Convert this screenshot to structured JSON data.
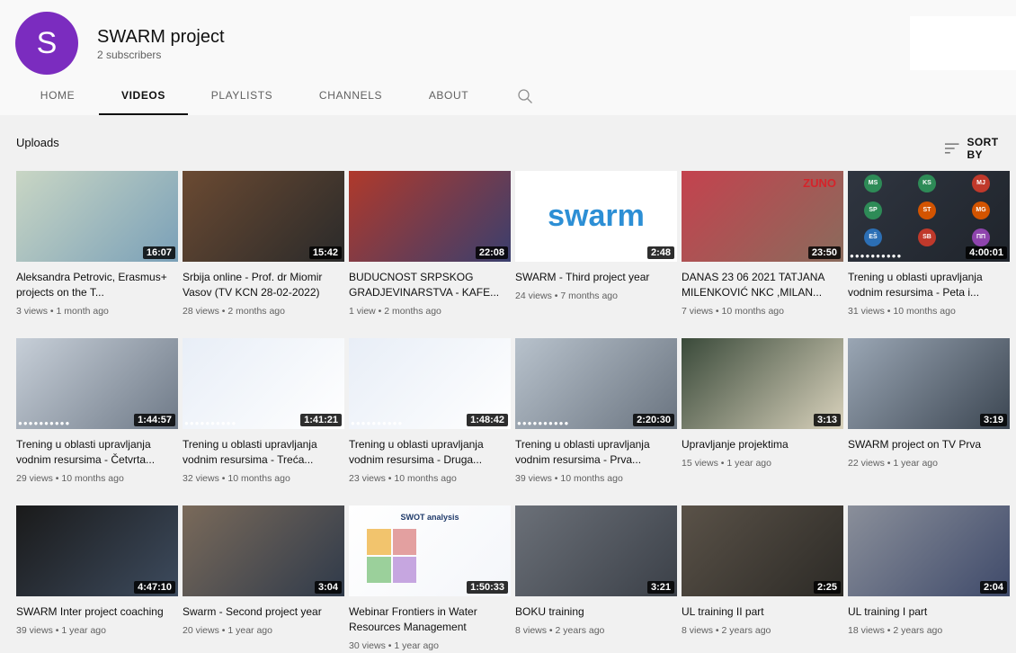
{
  "channel": {
    "avatar_letter": "S",
    "avatar_color": "#7b2cbf",
    "name": "SWARM project",
    "subscribers": "2 subscribers"
  },
  "tabs": [
    "HOME",
    "VIDEOS",
    "PLAYLISTS",
    "CHANNELS",
    "ABOUT"
  ],
  "active_tab": "VIDEOS",
  "section": {
    "label": "Uploads",
    "sort_label": "SORT BY"
  },
  "videos": [
    {
      "title": "Aleksandra Petrovic, Erasmus+ projects on the T...",
      "meta": "3 views • 1 month ago",
      "duration": "16:07"
    },
    {
      "title": "Srbija online - Prof. dr Miomir Vasov (TV KCN 28-02-2022)",
      "meta": "28 views • 2 months ago",
      "duration": "15:42"
    },
    {
      "title": "BUDUCNOST SRPSKOG GRADJEVINARSTVA - KAFE...",
      "meta": "1 view • 2 months ago",
      "duration": "22:08"
    },
    {
      "title": "SWARM - Third project year",
      "meta": "24 views • 7 months ago",
      "duration": "2:48",
      "thumb_text": "swarm"
    },
    {
      "title": "DANAS 23 06 2021 TATJANA MILENKOVIĆ NKC ,MILAN...",
      "meta": "7 views • 10 months ago",
      "duration": "23:50",
      "thumb_text": "ZUNO"
    },
    {
      "title": "Trening u oblasti upravljanja vodnim resursima - Peta i...",
      "meta": "31 views • 10 months ago",
      "duration": "4:00:01",
      "thumb_initials": [
        "MS",
        "KS",
        "MJ",
        "SP",
        "ST",
        "MG",
        "EŠ",
        "SB",
        "ПП"
      ]
    },
    {
      "title": "Trening u oblasti upravljanja vodnim resursima - Četvrta...",
      "meta": "29 views • 10 months ago",
      "duration": "1:44:57"
    },
    {
      "title": "Trening u oblasti upravljanja vodnim resursima - Treća...",
      "meta": "32 views • 10 months ago",
      "duration": "1:41:21"
    },
    {
      "title": "Trening u oblasti upravljanja vodnim resursima - Druga...",
      "meta": "23 views • 10 months ago",
      "duration": "1:48:42"
    },
    {
      "title": "Trening u oblasti upravljanja vodnim resursima - Prva...",
      "meta": "39 views • 10 months ago",
      "duration": "2:20:30"
    },
    {
      "title": "Upravljanje projektima",
      "meta": "15 views • 1 year ago",
      "duration": "3:13"
    },
    {
      "title": "SWARM project on TV Prva",
      "meta": "22 views • 1 year ago",
      "duration": "3:19"
    },
    {
      "title": "SWARM Inter project coaching",
      "meta": "39 views • 1 year ago",
      "duration": "4:47:10"
    },
    {
      "title": "Swarm - Second project year",
      "meta": "20 views • 1 year ago",
      "duration": "3:04"
    },
    {
      "title": "Webinar Frontiers in Water Resources Management",
      "meta": "30 views • 1 year ago",
      "duration": "1:50:33",
      "thumb_text": "SWOT analysis"
    },
    {
      "title": "BOKU training",
      "meta": "8 views • 2 years ago",
      "duration": "3:21"
    },
    {
      "title": "UL training II part",
      "meta": "8 views • 2 years ago",
      "duration": "2:25"
    },
    {
      "title": "UL training I part",
      "meta": "18 views • 2 years ago",
      "duration": "2:04"
    }
  ],
  "thumb_colors": [
    [
      "#c9d6c4",
      "#7aa0b8"
    ],
    [
      "#6b4a32",
      "#2a2a2a"
    ],
    [
      "#b0392b",
      "#3a3f6e"
    ],
    [
      "#ffffff",
      "#ffffff"
    ],
    [
      "#c4424e",
      "#8a6b5c"
    ],
    [
      "#2f3540",
      "#1f242b"
    ],
    [
      "#c7cfd8",
      "#6f7a88"
    ],
    [
      "#e8eef7",
      "#ffffff"
    ],
    [
      "#e8eef7",
      "#ffffff"
    ],
    [
      "#b8c2cc",
      "#6a7480"
    ],
    [
      "#3a4a3a",
      "#d9d2bc"
    ],
    [
      "#9aa6b4",
      "#3c4652"
    ],
    [
      "#1a1a1a",
      "#3d4b5e"
    ],
    [
      "#7a6a5a",
      "#2f3a4a"
    ],
    [
      "#ffffff",
      "#f4f6fa"
    ],
    [
      "#6b7078",
      "#3b4048"
    ],
    [
      "#5a5248",
      "#2c2a26"
    ],
    [
      "#8a8f9a",
      "#3f4a6a"
    ]
  ],
  "accent_colors": {
    "swarm_blue": "#2d8fd5",
    "zuno_red": "#d6232a"
  }
}
